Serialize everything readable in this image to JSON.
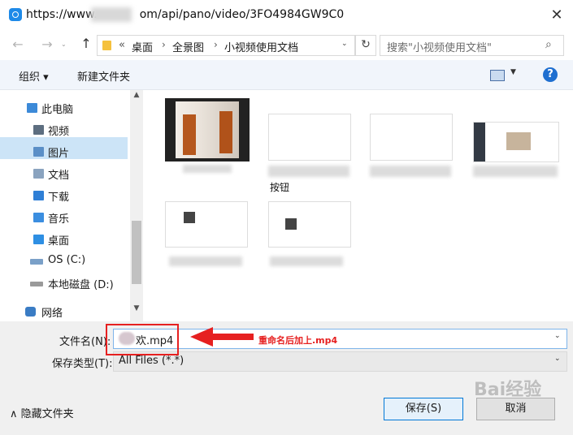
{
  "title_bar": {
    "url_prefix": "https://www.",
    "url_suffix": "om/api/pano/video/3FO4984GW9C0",
    "close_glyph": "✕"
  },
  "nav": {
    "back": "←",
    "forward": "→",
    "up": "↑",
    "overflow": "«",
    "breadcrumbs": [
      "桌面",
      "全景图",
      "小视频使用文档"
    ],
    "separator": "›",
    "refresh": "↻",
    "search_placeholder": "搜索\"小视频使用文档\"",
    "search_icon": "⌕"
  },
  "toolbar": {
    "organize": "组织 ▾",
    "new_folder": "新建文件夹",
    "view_caret": "▼",
    "help": "?"
  },
  "sidebar": {
    "items": [
      {
        "label": "此电脑",
        "icon": "computer-icon",
        "color": "#3c8ad8"
      },
      {
        "label": "视频",
        "icon": "video-folder-icon",
        "color": "#5d6e80"
      },
      {
        "label": "图片",
        "icon": "pictures-folder-icon",
        "color": "#5b8fc7"
      },
      {
        "label": "文档",
        "icon": "documents-folder-icon",
        "color": "#8aa3bf"
      },
      {
        "label": "下载",
        "icon": "downloads-folder-icon",
        "color": "#2f7fd6"
      },
      {
        "label": "音乐",
        "icon": "music-folder-icon",
        "color": "#3b8ee0"
      },
      {
        "label": "桌面",
        "icon": "desktop-folder-icon",
        "color": "#2e8fe3"
      },
      {
        "label": "OS (C:)",
        "icon": "os-drive-icon",
        "color": "#7aa0c8"
      },
      {
        "label": "本地磁盘 (D:)",
        "icon": "drive-icon",
        "color": "#9a9a9a"
      },
      {
        "label": "网络",
        "icon": "network-icon",
        "color": "#3a7cc4"
      }
    ],
    "scroll_up": "▲",
    "scroll_down": "▼"
  },
  "files": {
    "partial_caption": "按钮"
  },
  "bottom": {
    "filename_label": "文件名(N):",
    "filename_value": "欢.mp4",
    "filetype_label": "保存类型(T):",
    "filetype_value": "All Files (*.*)",
    "dropdown_glyph": "⌄",
    "annotation": "重命名后加上.mp4",
    "hide_folders": "隐藏文件夹",
    "hide_caret": "∧",
    "save": "保存(S)",
    "cancel": "取消",
    "watermark": "Bai经验"
  },
  "colors": {
    "accent": "#0078d7",
    "annotation_red": "#e62020",
    "selected_bg": "#cce4f7"
  }
}
